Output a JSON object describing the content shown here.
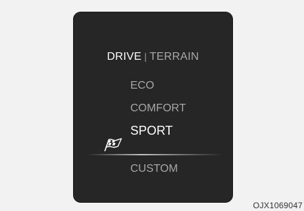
{
  "header": {
    "active": "DRIVE",
    "separator": "|",
    "inactive": "TERRAIN"
  },
  "menu": {
    "items": [
      {
        "label": "ECO"
      },
      {
        "label": "COMFORT"
      },
      {
        "label": "SPORT",
        "selected": true,
        "icon": "checkered-flag-icon"
      },
      {
        "label": "CUSTOM"
      }
    ]
  },
  "caption": "OJX1069047"
}
